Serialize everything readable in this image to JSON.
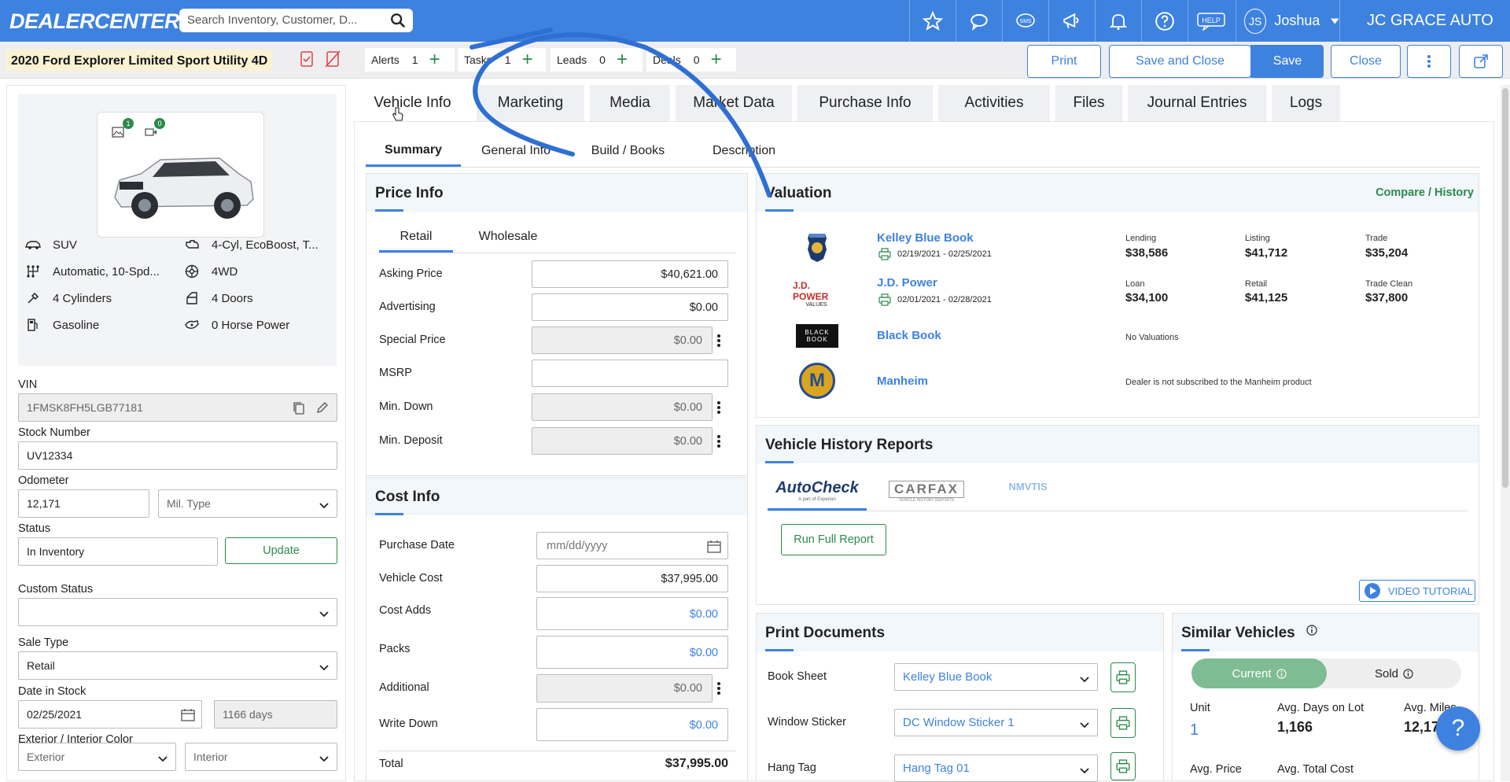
{
  "brand": "DEALERCENTER",
  "search": {
    "placeholder": "Search Inventory, Customer, D..."
  },
  "topbar": {
    "icons": [
      "star-icon",
      "chat-icon",
      "sms-icon",
      "megaphone-icon",
      "bell-icon",
      "question-icon",
      "help-icon"
    ],
    "sms_label": "SMS",
    "help_label": "HELP",
    "user_initials": "JS",
    "user_name": "Joshua",
    "dealer": "JC GRACE AUTO"
  },
  "vehicle_title": "2020 Ford Explorer Limited Sport Utility 4D",
  "counters": [
    {
      "label": "Alerts",
      "count": "1"
    },
    {
      "label": "Tasks",
      "count": "1"
    },
    {
      "label": "Leads",
      "count": "0"
    },
    {
      "label": "Deals",
      "count": "0"
    }
  ],
  "actions": {
    "print": "Print",
    "save_close": "Save and Close",
    "save": "Save",
    "close": "Close"
  },
  "photo_badges": {
    "images": "1",
    "videos": "0"
  },
  "specs": [
    {
      "icon": "body-icon",
      "text": "SUV"
    },
    {
      "icon": "engine-icon",
      "text": "4-Cyl, EcoBoost, T..."
    },
    {
      "icon": "transmission-icon",
      "text": "Automatic, 10-Spd..."
    },
    {
      "icon": "drivetrain-icon",
      "text": "4WD"
    },
    {
      "icon": "cylinder-icon",
      "text": "4 Cylinders"
    },
    {
      "icon": "door-icon",
      "text": "4 Doors"
    },
    {
      "icon": "fuel-icon",
      "text": "Gasoline"
    },
    {
      "icon": "horsepower-icon",
      "text": "0 Horse Power"
    }
  ],
  "form": {
    "vin_label": "VIN",
    "vin": "1FMSK8FH5LGB77181",
    "stock_label": "Stock Number",
    "stock": "UV12334",
    "odometer_label": "Odometer",
    "odometer": "12,171",
    "mil_type": "Mil. Type",
    "status_label": "Status",
    "status": "In Inventory",
    "update": "Update",
    "custom_status_label": "Custom Status",
    "sale_type_label": "Sale Type",
    "sale_type": "Retail",
    "date_stock_label": "Date in Stock",
    "date_stock": "02/25/2021",
    "days": "1166 days",
    "color_label": "Exterior / Interior Color",
    "exterior": "Exterior",
    "interior": "Interior"
  },
  "main_tabs": [
    "Vehicle Info",
    "Marketing",
    "Media",
    "Market Data",
    "Purchase Info",
    "Activities",
    "Files",
    "Journal Entries",
    "Logs"
  ],
  "sub_tabs": [
    "Summary",
    "General Info",
    "Build / Books",
    "Description"
  ],
  "price_info": {
    "title": "Price Info",
    "tabs": [
      "Retail",
      "Wholesale"
    ],
    "rows": [
      {
        "label": "Asking Price",
        "value": "$40,621.00"
      },
      {
        "label": "Advertising",
        "value": "$0.00"
      },
      {
        "label": "Special Price",
        "value": "$0.00"
      },
      {
        "label": "MSRP",
        "value": ""
      },
      {
        "label": "Min. Down",
        "value": "$0.00"
      },
      {
        "label": "Min. Deposit",
        "value": "$0.00"
      }
    ]
  },
  "cost_info": {
    "title": "Cost Info",
    "rows": [
      {
        "label": "Purchase Date",
        "value": "mm/dd/yyyy"
      },
      {
        "label": "Vehicle Cost",
        "value": "$37,995.00"
      },
      {
        "label": "Cost Adds",
        "value": "$0.00"
      },
      {
        "label": "Packs",
        "value": "$0.00"
      },
      {
        "label": "Additional",
        "value": "$0.00"
      },
      {
        "label": "Write Down",
        "value": "$0.00"
      }
    ],
    "total_label": "Total",
    "total": "$37,995.00"
  },
  "valuation": {
    "title": "Valuation",
    "compare": "Compare",
    "sep": "/",
    "history": "History",
    "kbb": {
      "name": "Kelley Blue Book",
      "dates": "02/19/2021 - 02/25/2021",
      "l1": "Lending",
      "v1": "$38,586",
      "l2": "Listing",
      "v2": "$41,712",
      "l3": "Trade",
      "v3": "$35,204"
    },
    "jdp": {
      "name": "J.D. Power",
      "logo1": "J.D. POWER",
      "logo2": "VALUES",
      "dates": "02/01/2021 - 02/28/2021",
      "l1": "Loan",
      "v1": "$34,100",
      "l2": "Retail",
      "v2": "$41,125",
      "l3": "Trade Clean",
      "v3": "$37,800"
    },
    "bb": {
      "name": "Black Book",
      "logo1": "BLACK",
      "logo2": "BOOK",
      "note": "No Valuations"
    },
    "man": {
      "name": "Manheim",
      "logo": "M",
      "note": "Dealer is not subscribed to the Manheim product"
    }
  },
  "history_reports": {
    "title": "Vehicle History Reports",
    "autocheck": "AutoCheck",
    "autocheck_sub": "A part of Experian",
    "carfax": "CARFAX",
    "carfax_sub": "VEHICLE HISTORY REPORTS",
    "nmvtis": "NMVTIS",
    "run": "Run Full Report",
    "video": "VIDEO TUTORIAL"
  },
  "print_docs": {
    "title": "Print Documents",
    "rows": [
      {
        "label": "Book Sheet",
        "value": "Kelley Blue Book"
      },
      {
        "label": "Window Sticker",
        "value": "DC Window Sticker 1"
      },
      {
        "label": "Hang Tag",
        "value": "Hang Tag 01"
      }
    ]
  },
  "similar": {
    "title": "Similar Vehicles",
    "current": "Current",
    "sold": "Sold",
    "unit_label": "Unit",
    "unit": "1",
    "days_label": "Avg. Days on Lot",
    "days": "1,166",
    "miles_label": "Avg. Miles",
    "miles": "12,171",
    "price_label": "Avg. Price",
    "cost_label": "Avg. Total Cost"
  },
  "help_bubble": "?",
  "colors": {
    "primary": "#3e82e0",
    "green": "#2b8a4a",
    "tab_bg": "#eef0f3"
  }
}
